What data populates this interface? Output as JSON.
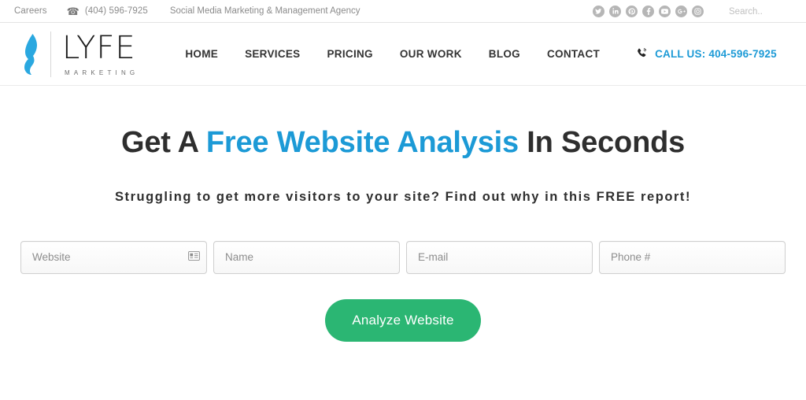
{
  "colors": {
    "accent_blue": "#1c9ad6",
    "button_green": "#2bb673",
    "text_dark": "#2e2e2e",
    "muted_gray": "#8b8b8b"
  },
  "topbar": {
    "careers_label": "Careers",
    "phone_icon": "telephone-icon",
    "phone": "(404) 596-7925",
    "tagline": "Social Media Marketing & Management Agency",
    "social": [
      {
        "name": "twitter",
        "label": "Twitter"
      },
      {
        "name": "linkedin",
        "label": "LinkedIn"
      },
      {
        "name": "pinterest",
        "label": "Pinterest"
      },
      {
        "name": "facebook",
        "label": "Facebook"
      },
      {
        "name": "youtube",
        "label": "YouTube"
      },
      {
        "name": "googleplus",
        "label": "Google Plus"
      },
      {
        "name": "instagram",
        "label": "Instagram"
      }
    ],
    "search_placeholder": "Search..",
    "search_value": ""
  },
  "header": {
    "logo": {
      "word": "LYFE",
      "sub": "MARKETING",
      "flame_icon": "flame-icon"
    },
    "nav": [
      {
        "label": "HOME",
        "key": "home"
      },
      {
        "label": "SERVICES",
        "key": "services"
      },
      {
        "label": "PRICING",
        "key": "pricing"
      },
      {
        "label": "OUR WORK",
        "key": "our-work"
      },
      {
        "label": "BLOG",
        "key": "blog"
      },
      {
        "label": "CONTACT",
        "key": "contact"
      }
    ],
    "cta": {
      "icon": "phone-signal-icon",
      "text": "CALL US: 404-596-7925"
    }
  },
  "hero": {
    "title_part1": "Get A ",
    "title_accent": "Free Website Analysis",
    "title_part2": " In Seconds",
    "subtitle": "Struggling to get more visitors to your site? Find out why in this FREE report!"
  },
  "form": {
    "fields": [
      {
        "key": "website",
        "placeholder": "Website",
        "value": "",
        "icon": "contact-card-icon"
      },
      {
        "key": "name",
        "placeholder": "Name",
        "value": "",
        "icon": ""
      },
      {
        "key": "email",
        "placeholder": "E-mail",
        "value": "",
        "icon": ""
      },
      {
        "key": "phone",
        "placeholder": "Phone #",
        "value": "",
        "icon": ""
      }
    ],
    "submit_label": "Analyze Website"
  }
}
